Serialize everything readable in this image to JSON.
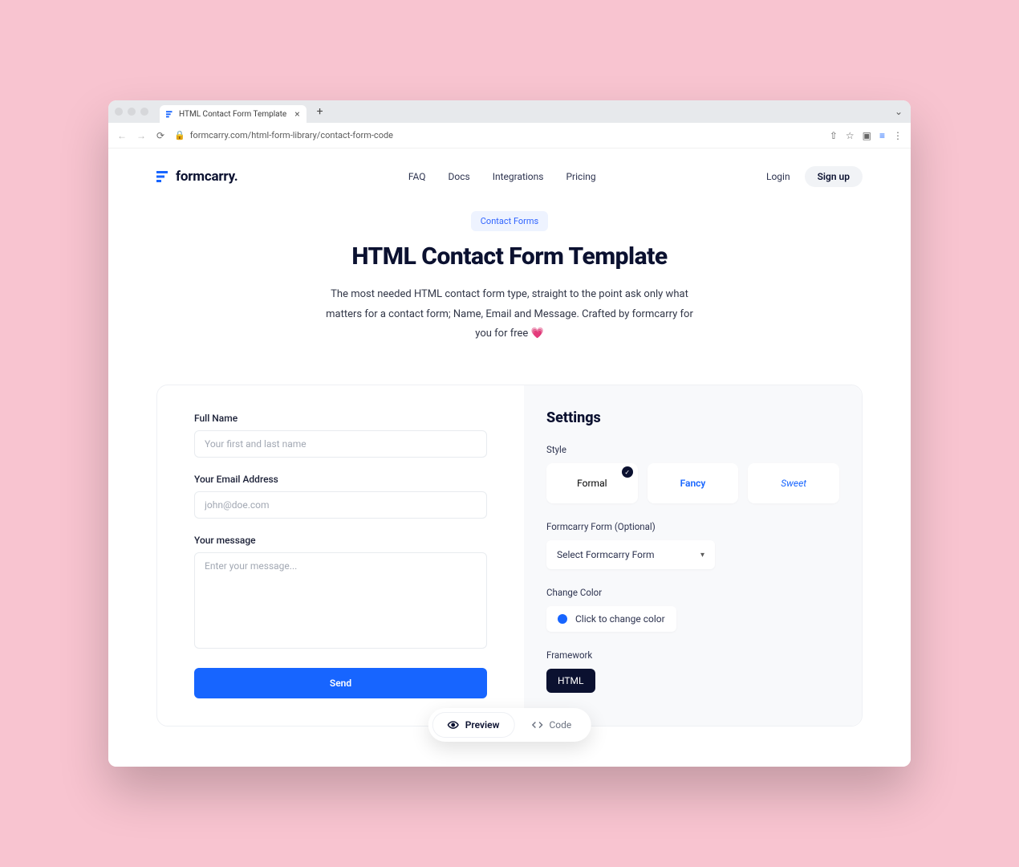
{
  "browser": {
    "tab_title": "HTML Contact Form Template",
    "url": "formcarry.com/html-form-library/contact-form-code"
  },
  "header": {
    "brand": "formcarry.",
    "nav": {
      "faq": "FAQ",
      "docs": "Docs",
      "integrations": "Integrations",
      "pricing": "Pricing"
    },
    "login": "Login",
    "signup": "Sign up"
  },
  "hero": {
    "chip": "Contact Forms",
    "title": "HTML Contact Form Template",
    "subtitle": "The most needed HTML contact form type, straight to the point ask only what matters for a contact form; Name, Email and Message. Crafted by formcarry for you for free 💗"
  },
  "form": {
    "name_label": "Full Name",
    "name_placeholder": "Your first and last name",
    "email_label": "Your Email Address",
    "email_placeholder": "john@doe.com",
    "message_label": "Your message",
    "message_placeholder": "Enter your message...",
    "submit": "Send"
  },
  "settings": {
    "title": "Settings",
    "style_label": "Style",
    "style_options": {
      "formal": "Formal",
      "fancy": "Fancy",
      "sweet": "Sweet"
    },
    "formcarry_label": "Formcarry Form (Optional)",
    "formcarry_placeholder": "Select Formcarry Form",
    "color_label": "Change Color",
    "color_button": "Click to change color",
    "framework_label": "Framework",
    "framework_value": "HTML"
  },
  "floatbar": {
    "preview": "Preview",
    "code": "Code"
  }
}
